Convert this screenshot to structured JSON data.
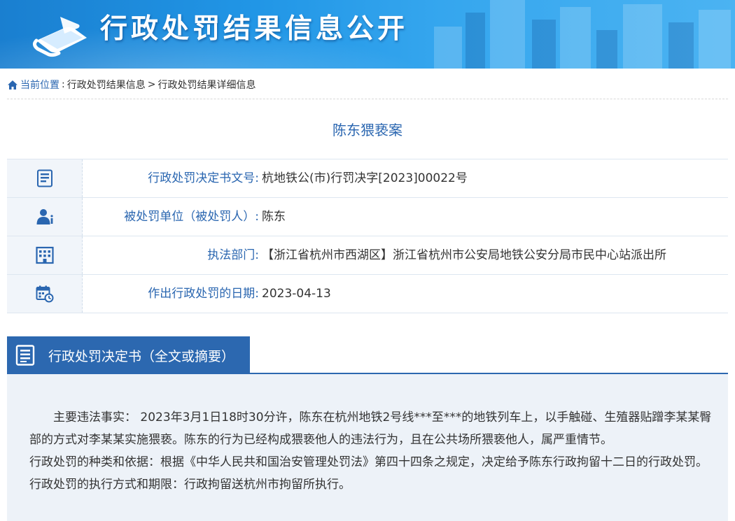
{
  "header": {
    "site_title": "行政处罚结果信息公开",
    "logo_icon": "book-icon"
  },
  "breadcrumb": {
    "label": "当前位置",
    "items": [
      "行政处罚结果信息",
      "行政处罚结果详细信息"
    ]
  },
  "case_title": "陈东猥亵案",
  "info_rows": [
    {
      "icon": "document-icon",
      "label": "行政处罚决定书文号",
      "value": "杭地铁公(市)行罚决字[2023]00022号"
    },
    {
      "icon": "person-icon",
      "label": "被处罚单位（被处罚人）",
      "value": "陈东"
    },
    {
      "icon": "building-icon",
      "label": "执法部门",
      "value": "【浙江省杭州市西湖区】浙江省杭州市公安局地铁公安分局市民中心站派出所"
    },
    {
      "icon": "calendar-icon",
      "label": "作出行政处罚的日期",
      "value": "2023-04-13"
    }
  ],
  "section": {
    "title": "行政处罚决定书（全文或摘要）",
    "icon": "document-icon"
  },
  "decision_text": [
    "主要违法事实： 2023年3月1日18时30分许，陈东在杭州地铁2号线***至***的地铁列车上，以手触碰、生殖器贴蹭李某某臀部的方式对李某某实施猥亵。陈东的行为已经构成猥亵他人的违法行为，且在公共场所猥亵他人，属严重情节。",
    "行政处罚的种类和依据：根据《中华人民共和国治安管理处罚法》第四十四条之规定，决定给予陈东行政拘留十二日的行政处罚。",
    "行政处罚的执行方式和期限：行政拘留送杭州市拘留所执行。"
  ],
  "colors": {
    "banner": "#2196e6",
    "accent_blue": "#2a66b0",
    "section_bg": "#2c68b0",
    "body_bg": "#edf2f8"
  }
}
